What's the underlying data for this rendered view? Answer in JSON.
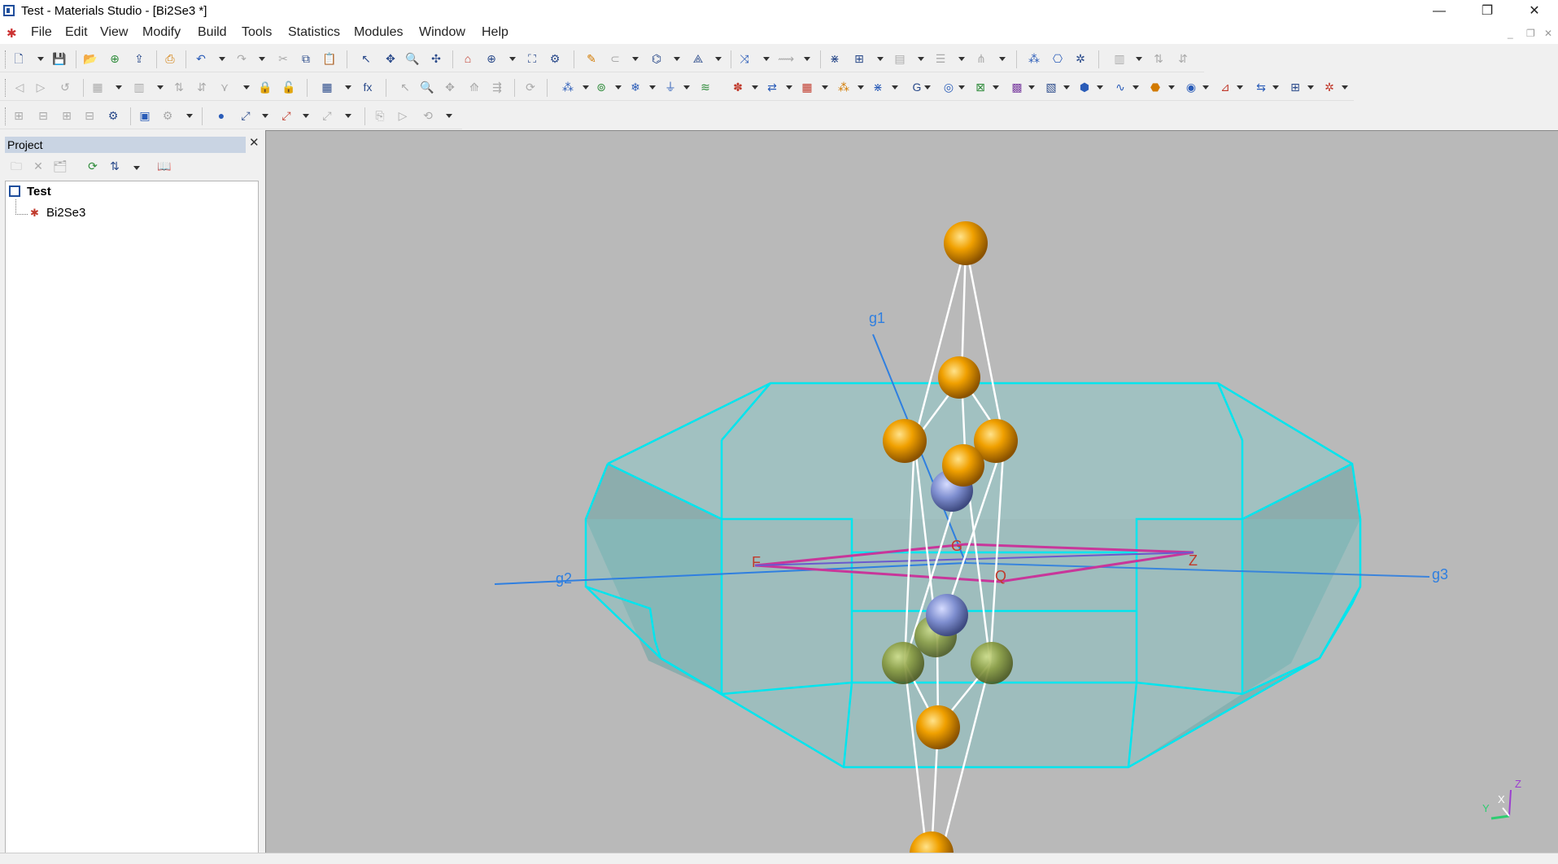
{
  "window": {
    "title": "Test - Materials Studio - [Bi2Se3 *]",
    "minimize": "—",
    "restore": "❐",
    "close": "✕"
  },
  "menu": {
    "items": [
      "File",
      "Edit",
      "View",
      "Modify",
      "Build",
      "Tools",
      "Statistics",
      "Modules",
      "Window",
      "Help"
    ]
  },
  "project": {
    "title": "Project",
    "close": "✕",
    "root": "Test",
    "child": "Bi2Se3"
  },
  "viewer": {
    "labels": {
      "g1": "g1",
      "g2": "g2",
      "g3": "g3",
      "F": "F",
      "Z": "Z",
      "G": "G",
      "Q": "Q"
    },
    "axes": {
      "x": "X",
      "y": "Y",
      "z": "Z"
    }
  },
  "colors": {
    "background": "#b9b9b9",
    "zone_fill": "#7fc3c3",
    "zone_edge": "#00e5ee",
    "path": "#c8369a",
    "reciprocal_axis": "#2f7fe0",
    "atom_bi": "#f0a000",
    "atom_se": "#7f8fd0",
    "atom_se_green": "#7d9a3c"
  }
}
